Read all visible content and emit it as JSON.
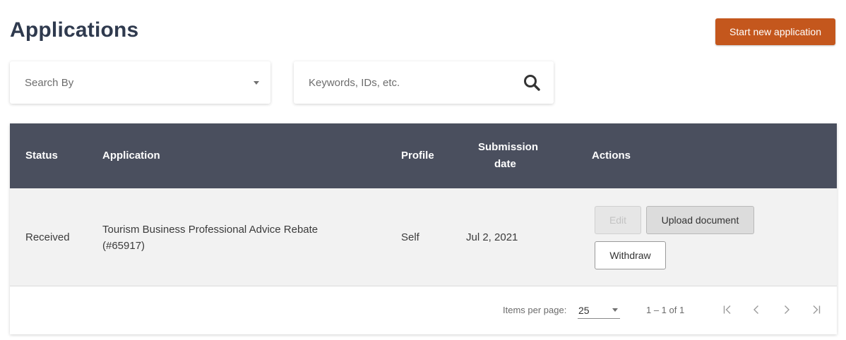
{
  "page": {
    "title": "Applications",
    "start_button": "Start new application"
  },
  "filters": {
    "search_by_placeholder": "Search By",
    "keywords_placeholder": "Keywords, IDs, etc."
  },
  "table": {
    "headers": {
      "status": "Status",
      "application": "Application",
      "profile": "Profile",
      "submission_date_line1": "Submission",
      "submission_date_line2": "date",
      "actions": "Actions"
    },
    "rows": [
      {
        "status": "Received",
        "application_line1": "Tourism Business Professional Advice Rebate",
        "application_line2": "(#65917)",
        "profile": "Self",
        "submission_date": "Jul 2, 2021",
        "actions": {
          "edit": "Edit",
          "upload": "Upload document",
          "withdraw": "Withdraw"
        }
      }
    ]
  },
  "pagination": {
    "items_per_page_label": "Items per page:",
    "items_per_page_value": "25",
    "range": "1 – 1 of 1"
  },
  "colors": {
    "accent": "#c4571d",
    "header_bg": "#4a4f5e",
    "title": "#2f3a4e"
  },
  "icons": {
    "search": "search-icon",
    "dropdown": "caret-down-icon",
    "first_page": "first-page-icon",
    "prev_page": "chevron-left-icon",
    "next_page": "chevron-right-icon",
    "last_page": "last-page-icon"
  }
}
